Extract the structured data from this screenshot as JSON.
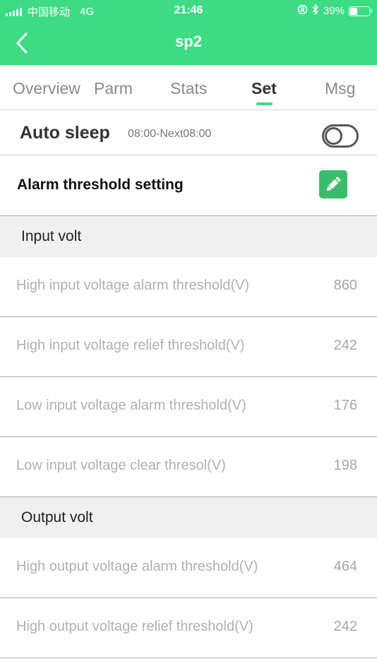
{
  "status_bar": {
    "carrier": "中国移动",
    "network": "4G",
    "time": "21:46",
    "battery_text": "39%",
    "battery_level": 0.39,
    "icons": [
      "signal-icon",
      "rotation-lock-icon",
      "bluetooth-icon",
      "battery-icon"
    ]
  },
  "header": {
    "title": "sp2",
    "back_icon": "chevron-left-icon"
  },
  "tabs": [
    {
      "label": "Overview",
      "active": false
    },
    {
      "label": "Parm",
      "active": false
    },
    {
      "label": "Stats",
      "active": false
    },
    {
      "label": "Set",
      "active": true
    },
    {
      "label": "Msg",
      "active": false
    }
  ],
  "auto_sleep": {
    "label": "Auto sleep",
    "time_range": "08:00-Next08:00",
    "enabled": false
  },
  "alarm_setting": {
    "label": "Alarm threshold setting",
    "edit_icon": "pencil-icon"
  },
  "sections": [
    {
      "title": "Input volt",
      "items": [
        {
          "label": "High input voltage alarm threshold(V)",
          "value": "860"
        },
        {
          "label": "High input voltage relief threshold(V)",
          "value": "242"
        },
        {
          "label": "Low input voltage alarm threshold(V)",
          "value": "176"
        },
        {
          "label": "Low input voltage clear thresol(V)",
          "value": "198"
        }
      ]
    },
    {
      "title": "Output volt",
      "items": [
        {
          "label": "High output voltage alarm threshold(V)",
          "value": "464"
        },
        {
          "label": "High output voltage relief threshold(V)",
          "value": "242"
        }
      ]
    }
  ],
  "colors": {
    "accent": "#3ddc84",
    "edit_button": "#3dbb6c",
    "section_bg": "#f0f0f0"
  }
}
